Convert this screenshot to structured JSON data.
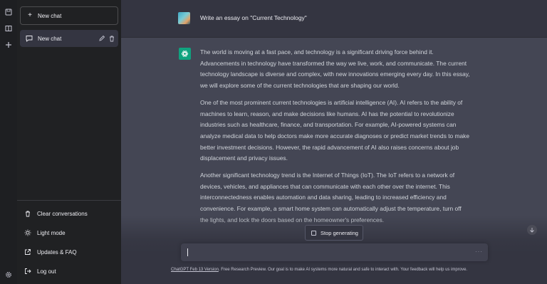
{
  "sidebar": {
    "new_chat_label": "New chat",
    "chats": [
      {
        "label": "New chat"
      }
    ],
    "bottom_links": [
      {
        "label": "Clear conversations",
        "icon": "trash-icon"
      },
      {
        "label": "Light mode",
        "icon": "sun-icon"
      },
      {
        "label": "Updates & FAQ",
        "icon": "external-link-icon"
      },
      {
        "label": "Log out",
        "icon": "logout-icon"
      }
    ]
  },
  "conversation": {
    "prompt": "Write an essay on \"Current Technology\"",
    "answer_paragraphs": [
      "The world is moving at a fast pace, and technology is a significant driving force behind it. Advancements in technology have transformed the way we live, work, and communicate. The current technology landscape is diverse and complex, with new innovations emerging every day. In this essay, we will explore some of the current technologies that are shaping our world.",
      "One of the most prominent current technologies is artificial intelligence (AI). AI refers to the ability of machines to learn, reason, and make decisions like humans. AI has the potential to revolutionize industries such as healthcare, finance, and transportation. For example, AI-powered systems can analyze medical data to help doctors make more accurate diagnoses or predict market trends to make better investment decisions. However, the rapid advancement of AI also raises concerns about job displacement and privacy issues.",
      "Another significant technology trend is the Internet of Things (IoT). The IoT refers to a network of devices, vehicles, and appliances that can communicate with each other over the internet. This interconnectedness enables automation and data sharing, leading to increased efficiency and convenience. For example, a smart home system can automatically adjust the temperature, turn off the lights, and lock the doors based on the homeowner's preferences."
    ]
  },
  "stop_generating_label": "Stop generating",
  "input": {
    "more_label": "···"
  },
  "footer": {
    "link_text": "ChatGPT Feb 13 Version",
    "text": ". Free Research Preview. Our goal is to make AI systems more natural and safe to interact with. Your feedback will help us improve."
  },
  "colors": {
    "bg": "#343541",
    "sidebar": "#202123",
    "answer_bg": "#444654",
    "brand_green": "#10a37f"
  }
}
